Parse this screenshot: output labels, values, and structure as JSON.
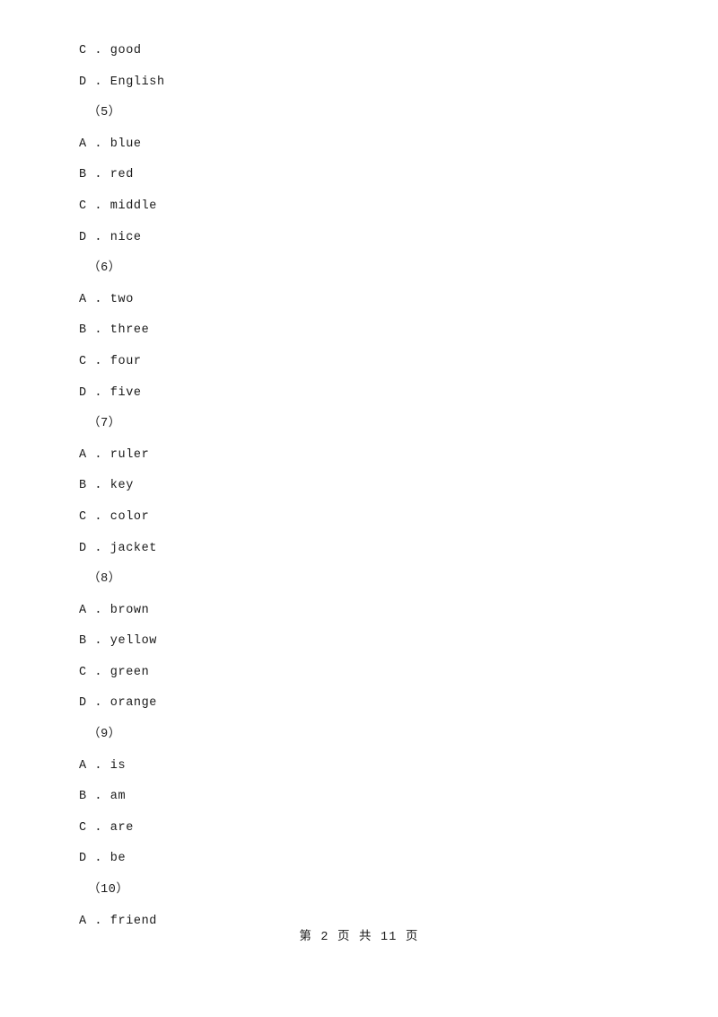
{
  "document": {
    "lines": [
      {
        "text": "C . good",
        "type": "option"
      },
      {
        "text": "D . English",
        "type": "option"
      },
      {
        "text": "（5）",
        "type": "group"
      },
      {
        "text": "A . blue",
        "type": "option"
      },
      {
        "text": "B . red",
        "type": "option"
      },
      {
        "text": "C . middle",
        "type": "option"
      },
      {
        "text": "D . nice",
        "type": "option"
      },
      {
        "text": "（6）",
        "type": "group"
      },
      {
        "text": "A . two",
        "type": "option"
      },
      {
        "text": "B . three",
        "type": "option"
      },
      {
        "text": "C . four",
        "type": "option"
      },
      {
        "text": "D . five",
        "type": "option"
      },
      {
        "text": "（7）",
        "type": "group"
      },
      {
        "text": "A . ruler",
        "type": "option"
      },
      {
        "text": "B . key",
        "type": "option"
      },
      {
        "text": "C . color",
        "type": "option"
      },
      {
        "text": "D . jacket",
        "type": "option"
      },
      {
        "text": "（8）",
        "type": "group"
      },
      {
        "text": "A . brown",
        "type": "option"
      },
      {
        "text": "B . yellow",
        "type": "option"
      },
      {
        "text": "C . green",
        "type": "option"
      },
      {
        "text": "D . orange",
        "type": "option"
      },
      {
        "text": "（9）",
        "type": "group"
      },
      {
        "text": "A . is",
        "type": "option"
      },
      {
        "text": "B . am",
        "type": "option"
      },
      {
        "text": "C . are",
        "type": "option"
      },
      {
        "text": "D . be",
        "type": "option"
      },
      {
        "text": "（10）",
        "type": "group"
      },
      {
        "text": "A . friend",
        "type": "option"
      }
    ],
    "footer": "第 2 页 共 11 页"
  }
}
